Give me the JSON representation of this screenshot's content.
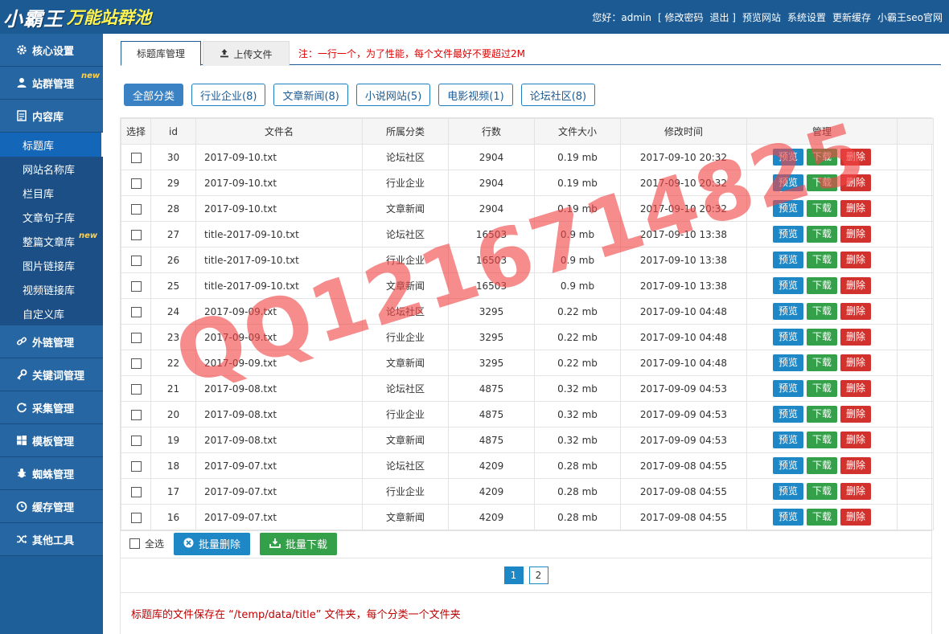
{
  "header": {
    "logo_main": "小霸王",
    "logo_sub": "万能站群池",
    "greeting": "您好：admin",
    "links": [
      "[ 修改密码",
      "退出 ]",
      "预览网站",
      "系统设置",
      "更新缓存",
      "小霸王seo官网"
    ]
  },
  "sidebar": {
    "groups": [
      {
        "label": "核心设置",
        "icon": "gear-icon"
      },
      {
        "label": "站群管理",
        "icon": "user-icon",
        "badge": "new"
      },
      {
        "label": "内容库",
        "icon": "document-icon"
      }
    ],
    "content_items": [
      {
        "label": "标题库",
        "active": true
      },
      {
        "label": "网站名称库"
      },
      {
        "label": "栏目库"
      },
      {
        "label": "文章句子库"
      },
      {
        "label": "整篇文章库",
        "badge": "new"
      },
      {
        "label": "图片链接库"
      },
      {
        "label": "视频链接库"
      },
      {
        "label": "自定义库"
      }
    ],
    "groups_after": [
      {
        "label": "外链管理",
        "icon": "link-icon"
      },
      {
        "label": "关键词管理",
        "icon": "key-icon"
      },
      {
        "label": "采集管理",
        "icon": "refresh-icon"
      },
      {
        "label": "模板管理",
        "icon": "windows-icon"
      },
      {
        "label": "蜘蛛管理",
        "icon": "bug-icon"
      },
      {
        "label": "缓存管理",
        "icon": "clock-icon"
      },
      {
        "label": "其他工具",
        "icon": "shuffle-icon"
      }
    ]
  },
  "tabs": {
    "items": [
      "标题库管理",
      "上传文件"
    ],
    "note": "注：一行一个，为了性能，每个文件最好不要超过2M"
  },
  "categories": [
    "全部分类",
    "行业企业(8)",
    "文章新闻(8)",
    "小说网站(5)",
    "电影视频(1)",
    "论坛社区(8)"
  ],
  "table": {
    "headers": [
      "选择",
      "id",
      "文件名",
      "所属分类",
      "行数",
      "文件大小",
      "修改时间",
      "管理"
    ],
    "actions": {
      "preview": "预览",
      "download": "下载",
      "delete": "删除"
    },
    "rows": [
      {
        "id": "30",
        "file": "2017-09-10.txt",
        "category": "论坛社区",
        "lines": "2904",
        "size": "0.19 mb",
        "modified": "2017-09-10 20:32"
      },
      {
        "id": "29",
        "file": "2017-09-10.txt",
        "category": "行业企业",
        "lines": "2904",
        "size": "0.19 mb",
        "modified": "2017-09-10 20:32"
      },
      {
        "id": "28",
        "file": "2017-09-10.txt",
        "category": "文章新闻",
        "lines": "2904",
        "size": "0.19 mb",
        "modified": "2017-09-10 20:32"
      },
      {
        "id": "27",
        "file": "title-2017-09-10.txt",
        "category": "论坛社区",
        "lines": "16503",
        "size": "0.9 mb",
        "modified": "2017-09-10 13:38"
      },
      {
        "id": "26",
        "file": "title-2017-09-10.txt",
        "category": "行业企业",
        "lines": "16503",
        "size": "0.9 mb",
        "modified": "2017-09-10 13:38"
      },
      {
        "id": "25",
        "file": "title-2017-09-10.txt",
        "category": "文章新闻",
        "lines": "16503",
        "size": "0.9 mb",
        "modified": "2017-09-10 13:38"
      },
      {
        "id": "24",
        "file": "2017-09-09.txt",
        "category": "论坛社区",
        "lines": "3295",
        "size": "0.22 mb",
        "modified": "2017-09-10 04:48"
      },
      {
        "id": "23",
        "file": "2017-09-09.txt",
        "category": "行业企业",
        "lines": "3295",
        "size": "0.22 mb",
        "modified": "2017-09-10 04:48"
      },
      {
        "id": "22",
        "file": "2017-09-09.txt",
        "category": "文章新闻",
        "lines": "3295",
        "size": "0.22 mb",
        "modified": "2017-09-10 04:48"
      },
      {
        "id": "21",
        "file": "2017-09-08.txt",
        "category": "论坛社区",
        "lines": "4875",
        "size": "0.32 mb",
        "modified": "2017-09-09 04:53"
      },
      {
        "id": "20",
        "file": "2017-09-08.txt",
        "category": "行业企业",
        "lines": "4875",
        "size": "0.32 mb",
        "modified": "2017-09-09 04:53"
      },
      {
        "id": "19",
        "file": "2017-09-08.txt",
        "category": "文章新闻",
        "lines": "4875",
        "size": "0.32 mb",
        "modified": "2017-09-09 04:53"
      },
      {
        "id": "18",
        "file": "2017-09-07.txt",
        "category": "论坛社区",
        "lines": "4209",
        "size": "0.28 mb",
        "modified": "2017-09-08 04:55"
      },
      {
        "id": "17",
        "file": "2017-09-07.txt",
        "category": "行业企业",
        "lines": "4209",
        "size": "0.28 mb",
        "modified": "2017-09-08 04:55"
      },
      {
        "id": "16",
        "file": "2017-09-07.txt",
        "category": "文章新闻",
        "lines": "4209",
        "size": "0.28 mb",
        "modified": "2017-09-08 04:55"
      }
    ]
  },
  "bulk": {
    "select_all": "全选",
    "delete": "批量删除",
    "download": "批量下载"
  },
  "pagination": {
    "pages": [
      "1",
      "2"
    ],
    "current": "1"
  },
  "footer_note": "标题库的文件保存在 “/temp/data/title” 文件夹，每个分类一个文件夹",
  "watermark": "QQ1216714825",
  "colors": {
    "header": "#1c5a93",
    "sidebar": "#1e5e99",
    "preview": "#1e88c7",
    "download": "#35a04a",
    "delete": "#d2322d",
    "note_red": "#e10000"
  }
}
